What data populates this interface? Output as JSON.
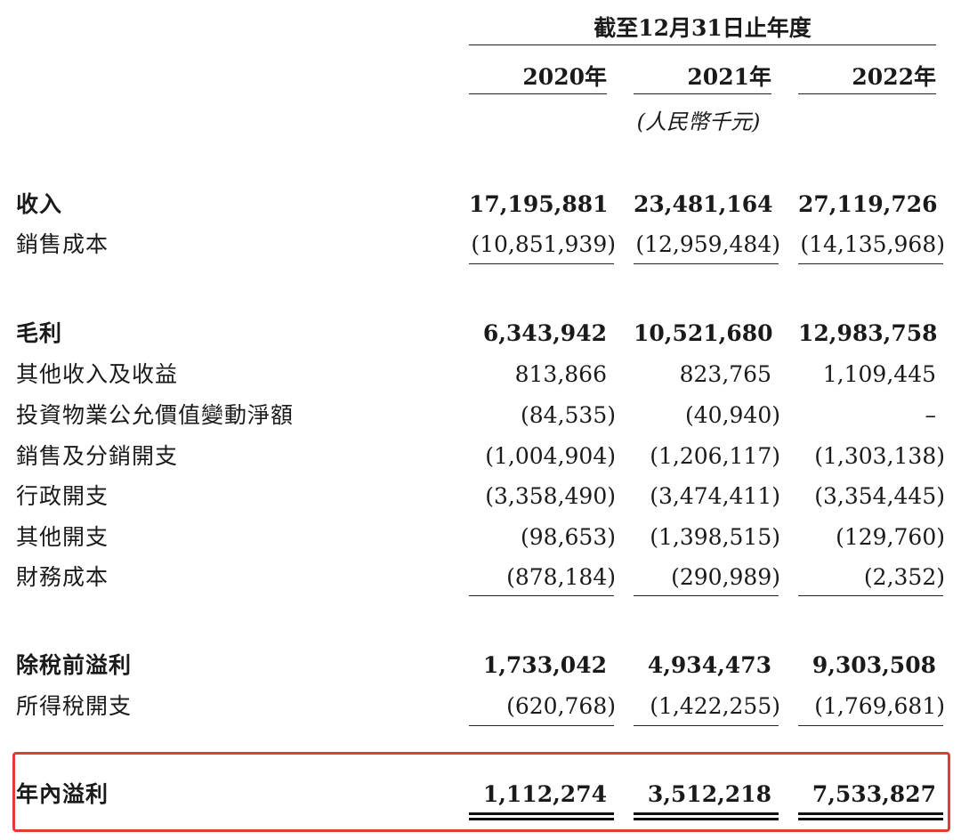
{
  "header": {
    "period": "截至12月31日止年度",
    "years": [
      "2020年",
      "2021年",
      "2022年"
    ],
    "unit": "(人民幣千元)"
  },
  "rows": [
    {
      "label": "收入",
      "bold": true,
      "values": [
        "17,195,881",
        "23,481,164",
        "27,119,726"
      ]
    },
    {
      "label": "銷售成本",
      "bold": false,
      "values": [
        "(10,851,939)",
        "(12,959,484)",
        "(14,135,968)"
      ]
    },
    {
      "label": "毛利",
      "bold": true,
      "values": [
        "6,343,942",
        "10,521,680",
        "12,983,758"
      ]
    },
    {
      "label": "其他收入及收益",
      "bold": false,
      "values": [
        "813,866",
        "823,765",
        "1,109,445"
      ]
    },
    {
      "label": "投資物業公允價值變動淨額",
      "bold": false,
      "values": [
        "(84,535)",
        "(40,940)",
        "–"
      ]
    },
    {
      "label": "銷售及分銷開支",
      "bold": false,
      "values": [
        "(1,004,904)",
        "(1,206,117)",
        "(1,303,138)"
      ]
    },
    {
      "label": "行政開支",
      "bold": false,
      "values": [
        "(3,358,490)",
        "(3,474,411)",
        "(3,354,445)"
      ]
    },
    {
      "label": "其他開支",
      "bold": false,
      "values": [
        "(98,653)",
        "(1,398,515)",
        "(129,760)"
      ]
    },
    {
      "label": "財務成本",
      "bold": false,
      "values": [
        "(878,184)",
        "(290,989)",
        "(2,352)"
      ]
    },
    {
      "label": "除稅前溢利",
      "bold": true,
      "values": [
        "1,733,042",
        "4,934,473",
        "9,303,508"
      ]
    },
    {
      "label": "所得稅開支",
      "bold": false,
      "values": [
        "(620,768)",
        "(1,422,255)",
        "(1,769,681)"
      ]
    },
    {
      "label": "年內溢利",
      "bold": true,
      "values": [
        "1,112,274",
        "3,512,218",
        "7,533,827"
      ]
    }
  ],
  "highlight_color": "#e53935"
}
